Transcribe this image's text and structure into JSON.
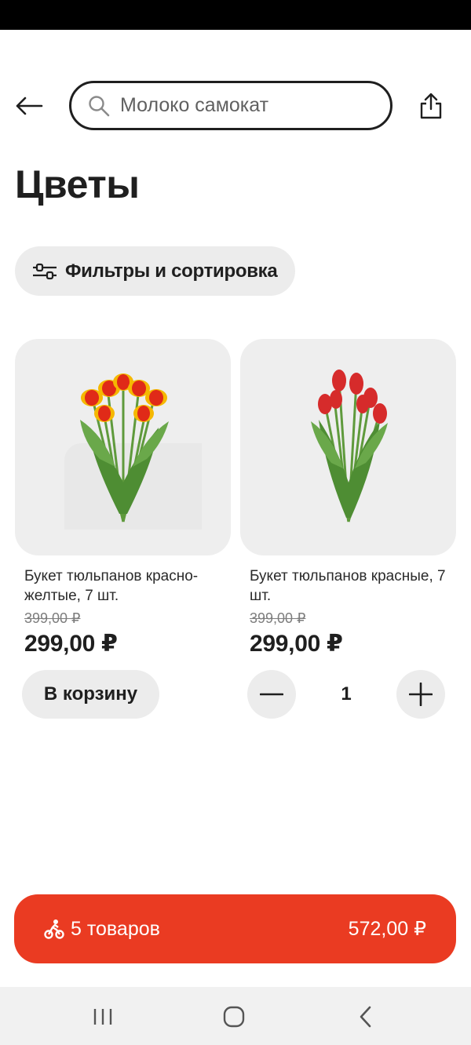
{
  "header": {
    "search_placeholder": "Молоко самокат",
    "icons": {
      "back": "arrow-left-icon",
      "search": "search-icon",
      "share": "share-icon"
    }
  },
  "page": {
    "title": "Цветы",
    "filter_label": "Фильтры и сортировка",
    "filter_icon": "sliders-icon"
  },
  "products": [
    {
      "name": "Букет тюльпанов красно-желтые, 7 шт.",
      "old_price": "399,00 ₽",
      "price": "299,00 ₽",
      "add_label": "В корзину",
      "image": "red-yellow-tulip-bouquet"
    },
    {
      "name": "Букет тюльпанов красные, 7 шт.",
      "old_price": "399,00 ₽",
      "price": "299,00 ₽",
      "quantity": "1",
      "image": "red-tulip-bouquet"
    }
  ],
  "cart": {
    "count_label": "5 товаров",
    "total": "572,00 ₽",
    "icon": "bike-icon"
  },
  "colors": {
    "accent": "#ea3b22",
    "chip_bg": "#ececec",
    "text": "#1f1f1f"
  },
  "system_nav": {
    "icons": [
      "recent-apps-icon",
      "home-icon",
      "back-icon"
    ]
  }
}
